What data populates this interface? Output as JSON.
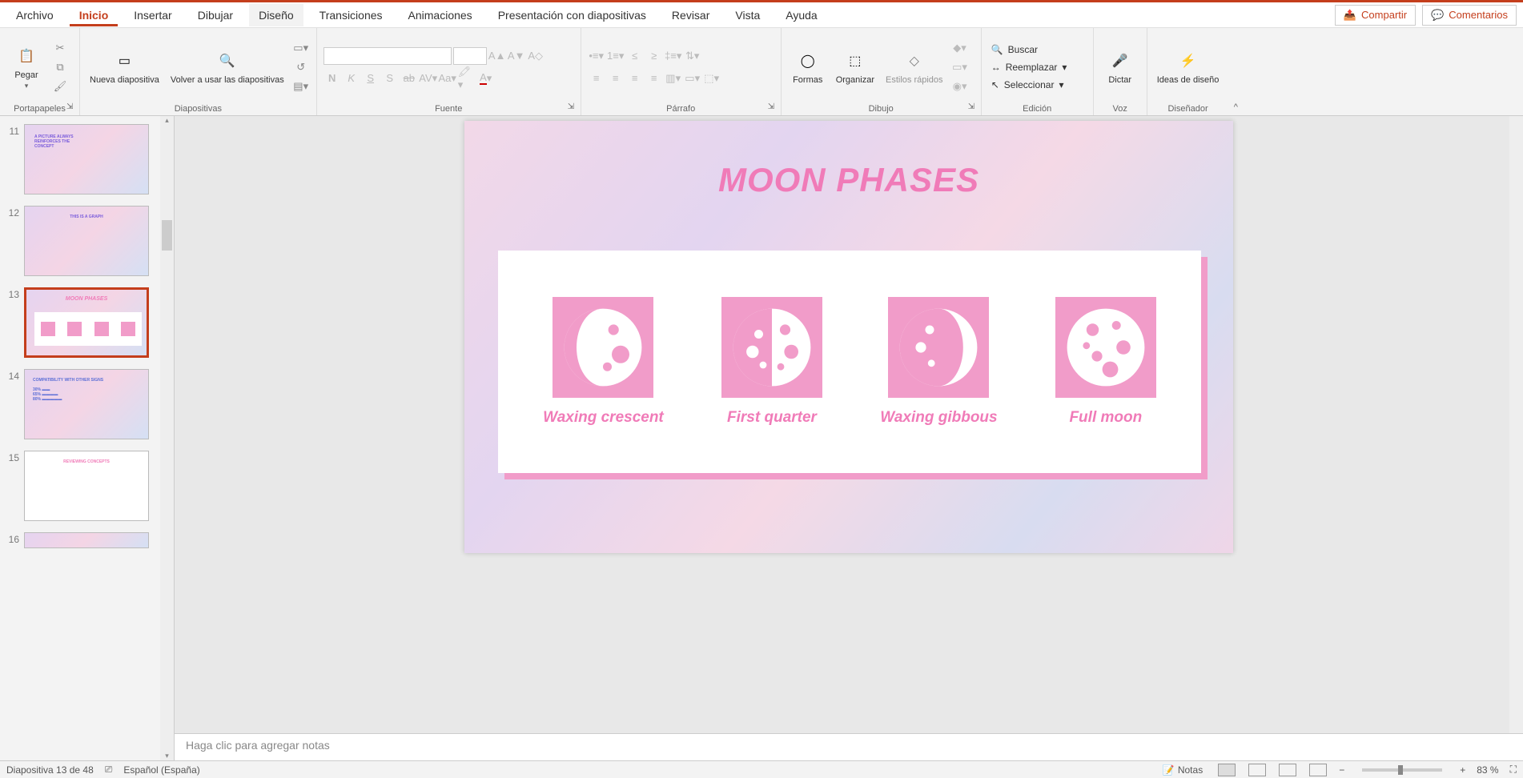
{
  "tabs": {
    "archivo": "Archivo",
    "inicio": "Inicio",
    "insertar": "Insertar",
    "dibujar": "Dibujar",
    "diseno": "Diseño",
    "transiciones": "Transiciones",
    "animaciones": "Animaciones",
    "presentacion": "Presentación con diapositivas",
    "revisar": "Revisar",
    "vista": "Vista",
    "ayuda": "Ayuda"
  },
  "header": {
    "share": "Compartir",
    "comments": "Comentarios"
  },
  "ribbon": {
    "portapapeles": {
      "label": "Portapapeles",
      "pegar": "Pegar"
    },
    "diapositivas": {
      "label": "Diapositivas",
      "nueva": "Nueva diapositiva",
      "reusar": "Volver a usar las diapositivas"
    },
    "fuente": {
      "label": "Fuente"
    },
    "parrafo": {
      "label": "Párrafo"
    },
    "dibujo": {
      "label": "Dibujo",
      "formas": "Formas",
      "organizar": "Organizar",
      "estilos": "Estilos rápidos"
    },
    "edicion": {
      "label": "Edición",
      "buscar": "Buscar",
      "reemplazar": "Reemplazar",
      "seleccionar": "Seleccionar"
    },
    "voz": {
      "label": "Voz",
      "dictar": "Dictar"
    },
    "disenador": {
      "label": "Diseñador",
      "ideas": "Ideas de diseño"
    }
  },
  "thumbs": {
    "n11": "11",
    "n12": "12",
    "n13": "13",
    "n14": "14",
    "n15": "15",
    "n16": "16"
  },
  "slide": {
    "title": "MOON PHASES",
    "phase1": "Waxing crescent",
    "phase2": "First quarter",
    "phase3": "Waxing gibbous",
    "phase4": "Full moon"
  },
  "notes": {
    "placeholder": "Haga clic para agregar notas"
  },
  "status": {
    "slide_info": "Diapositiva 13 de 48",
    "lang": "Español (España)",
    "notas": "Notas",
    "zoom": "83 %"
  }
}
